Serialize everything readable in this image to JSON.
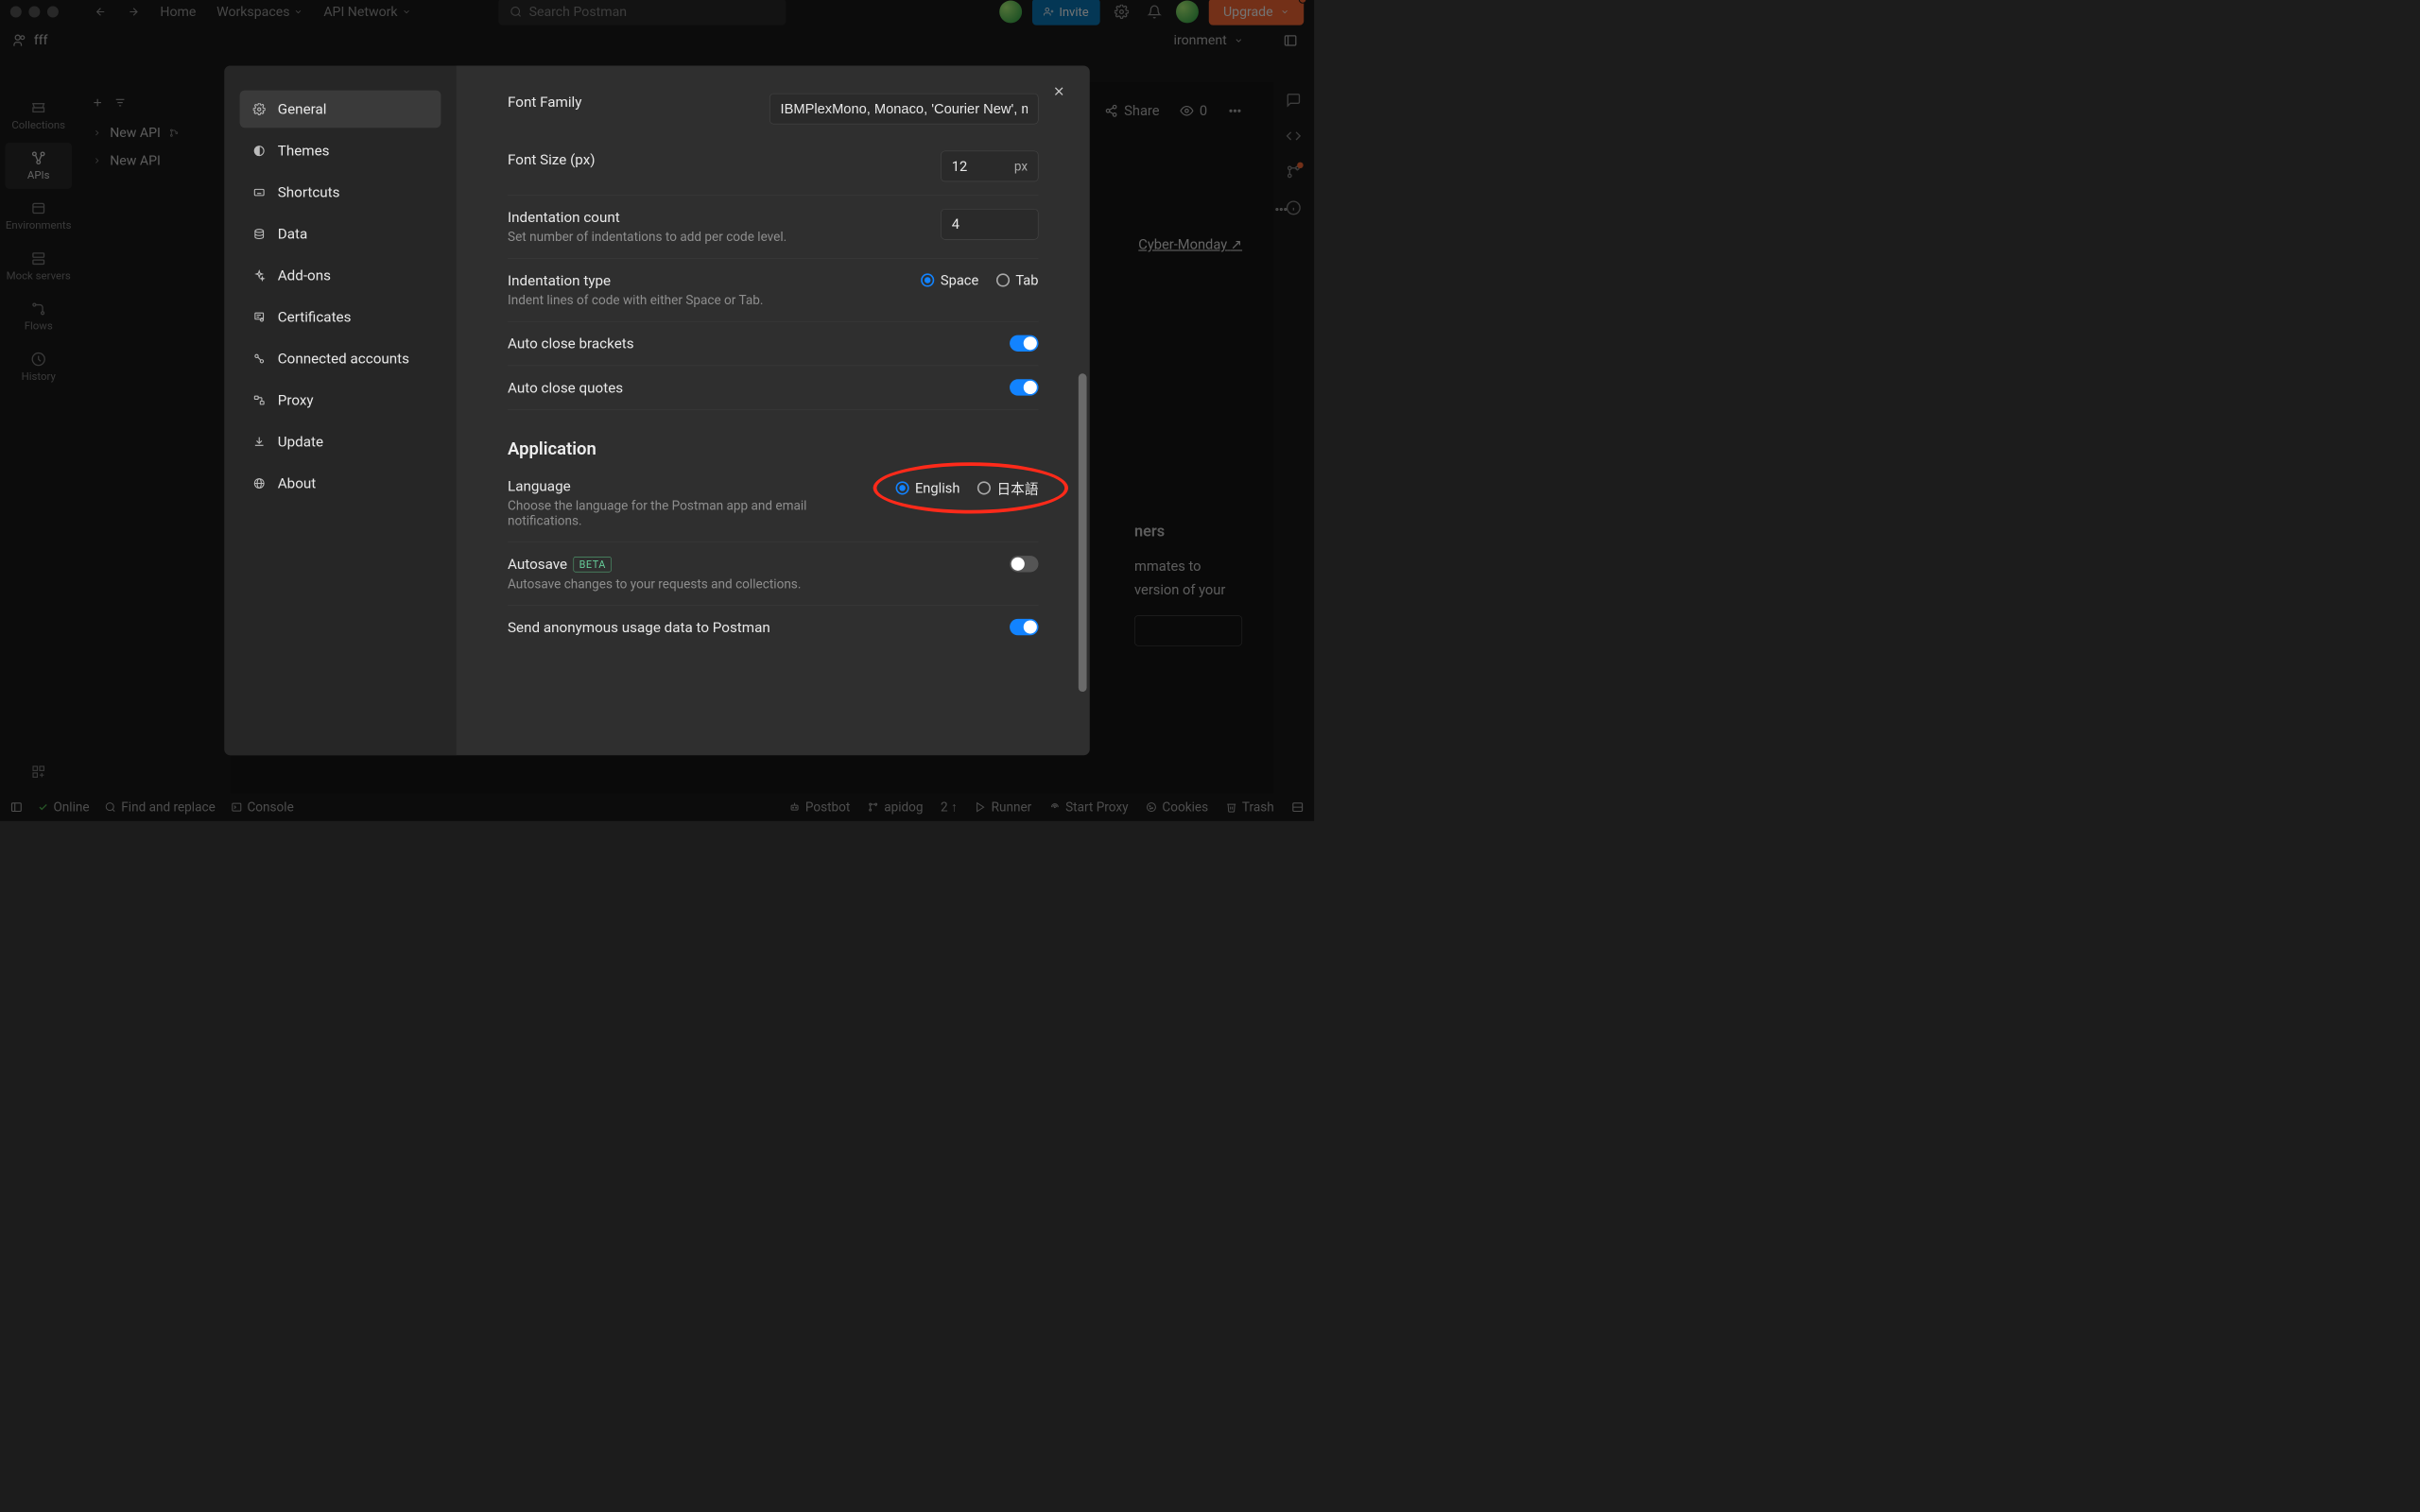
{
  "header": {
    "home": "Home",
    "workspaces": "Workspaces",
    "api_network": "API Network",
    "search_placeholder": "Search Postman",
    "invite": "Invite",
    "upgrade": "Upgrade"
  },
  "subheader": {
    "workspace": "fff",
    "environment_label": "ironment"
  },
  "sidebar": {
    "items": [
      {
        "label": "Collections"
      },
      {
        "label": "APIs"
      },
      {
        "label": "Environments"
      },
      {
        "label": "Mock servers"
      },
      {
        "label": "Flows"
      },
      {
        "label": "History"
      }
    ]
  },
  "tree": {
    "items": [
      {
        "label": "New API"
      },
      {
        "label": "New API"
      }
    ]
  },
  "content_actions": {
    "share": "Share",
    "watch_count": "0",
    "link_text": "Cyber-Monday"
  },
  "settings": {
    "nav": {
      "general": "General",
      "themes": "Themes",
      "shortcuts": "Shortcuts",
      "data": "Data",
      "addons": "Add-ons",
      "certificates": "Certificates",
      "connected": "Connected accounts",
      "proxy": "Proxy",
      "update": "Update",
      "about": "About"
    },
    "font_family_label": "Font Family",
    "font_family_value": "IBMPlexMono, Monaco, 'Courier New', mon",
    "font_size_label": "Font Size (px)",
    "font_size_value": "12",
    "font_size_unit": "px",
    "indent_count_label": "Indentation count",
    "indent_count_desc": "Set number of indentations to add per code level.",
    "indent_count_value": "4",
    "indent_type_label": "Indentation type",
    "indent_type_desc": "Indent lines of code with either Space or Tab.",
    "indent_type_opts": {
      "space": "Space",
      "tab": "Tab"
    },
    "auto_close_brackets": "Auto close brackets",
    "auto_close_quotes": "Auto close quotes",
    "application_header": "Application",
    "language_label": "Language",
    "language_desc": "Choose the language for the Postman app and email notifications.",
    "language_opts": {
      "en": "English",
      "ja": "日本語"
    },
    "autosave_label": "Autosave",
    "autosave_badge": "BETA",
    "autosave_desc": "Autosave changes to your requests and collections.",
    "anon_data_label": "Send anonymous usage data to Postman"
  },
  "bottom": {
    "online": "Online",
    "find": "Find and replace",
    "console": "Console",
    "postbot": "Postbot",
    "branch": "apidog",
    "changes": "2 ↑",
    "runner": "Runner",
    "start_proxy": "Start Proxy",
    "cookies": "Cookies",
    "trash": "Trash"
  },
  "hidden_panel": {
    "heading_tail": "ners",
    "line1_tail": "mmates to",
    "line2_tail": "version of your"
  }
}
